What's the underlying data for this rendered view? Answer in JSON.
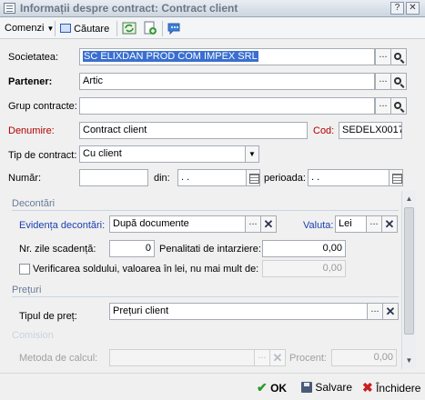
{
  "window": {
    "title": "Informații despre contract: Contract client",
    "controls": {
      "help": "?",
      "close": "✕"
    }
  },
  "toolbar": {
    "comenzi_label": "Comenzi",
    "cautare_label": "Căutare"
  },
  "form": {
    "societatea": {
      "label": "Societatea:",
      "value": "SC ELIXDAN PROD COM IMPEX SRL"
    },
    "partener": {
      "label": "Partener:",
      "value": "Artic"
    },
    "grup_contracte": {
      "label": "Grup contracte:",
      "value": ""
    },
    "denumire": {
      "label": "Denumire:",
      "value": "Contract client"
    },
    "cod": {
      "label": "Cod:",
      "value": "SEDELX0017"
    },
    "tip_contract": {
      "label": "Tip de contract:",
      "value": "Cu client"
    },
    "numar": {
      "label": "Număr:",
      "value": ""
    },
    "din": {
      "label": "din:",
      "value": " .  ."
    },
    "perioada": {
      "label": "perioada:",
      "value": " .  ."
    }
  },
  "decontari": {
    "section_title": "Decontări",
    "evidenta": {
      "label": "Evidența decontări:",
      "value": "După documente"
    },
    "valuta": {
      "label": "Valuta:",
      "value": "Lei"
    },
    "nr_zile": {
      "label": "Nr. zile scadență:",
      "value": "0"
    },
    "penalitati": {
      "label": "Penalitati de intarziere:",
      "value": "0,00"
    },
    "verificare": {
      "label": "Verificarea soldului, valoarea în lei, nu mai mult de:",
      "value": "0,00",
      "checked": false
    }
  },
  "preturi": {
    "section_title": "Prețuri",
    "tipul_pret": {
      "label": "Tipul de preț:",
      "value": "Prețuri client"
    }
  },
  "comision": {
    "section_title": "Comision",
    "metoda": {
      "label": "Metoda de calcul:",
      "value": ""
    },
    "procent": {
      "label": "Procent:",
      "value": "0,00"
    }
  },
  "footer": {
    "ok_label": "OK",
    "salvare_label": "Salvare",
    "inchidere_label": "Închidere"
  },
  "colors": {
    "accent_blue": "#1a3fb0",
    "required_red": "#b00000",
    "selection": "#3a6fcf"
  }
}
